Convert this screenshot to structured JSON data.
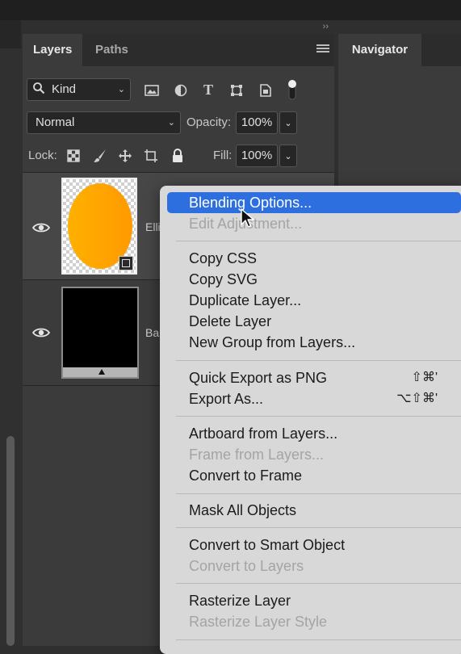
{
  "header": {
    "collapse_glyph": "››"
  },
  "panel": {
    "tabs": [
      {
        "label": "Layers"
      },
      {
        "label": "Paths"
      }
    ],
    "navigator_tab": "Navigator"
  },
  "filter": {
    "kind_label": "Kind"
  },
  "blend": {
    "mode": "Normal",
    "opacity_label": "Opacity:",
    "opacity_value": "100%"
  },
  "lock": {
    "label": "Lock:",
    "fill_label": "Fill:",
    "fill_value": "100%"
  },
  "layers": [
    {
      "name": "Elli",
      "thumb": "orange-ellipse"
    },
    {
      "name": "Ba",
      "thumb": "black-artboard"
    }
  ],
  "context_menu": {
    "groups": [
      [
        {
          "label": "Blending Options...",
          "highlighted": true
        },
        {
          "label": "Edit Adjustment...",
          "disabled": true
        }
      ],
      [
        {
          "label": "Copy CSS"
        },
        {
          "label": "Copy SVG"
        },
        {
          "label": "Duplicate Layer..."
        },
        {
          "label": "Delete Layer"
        },
        {
          "label": "New Group from Layers..."
        }
      ],
      [
        {
          "label": "Quick Export as PNG",
          "shortcut": "⇧⌘'"
        },
        {
          "label": "Export As...",
          "shortcut": "⌥⇧⌘'"
        }
      ],
      [
        {
          "label": "Artboard from Layers..."
        },
        {
          "label": "Frame from Layers...",
          "disabled": true
        },
        {
          "label": "Convert to Frame"
        }
      ],
      [
        {
          "label": "Mask All Objects"
        }
      ],
      [
        {
          "label": "Convert to Smart Object"
        },
        {
          "label": "Convert to Layers",
          "disabled": true
        }
      ],
      [
        {
          "label": "Rasterize Layer"
        },
        {
          "label": "Rasterize Layer Style",
          "disabled": true
        }
      ]
    ]
  },
  "colors": {
    "highlight": "#2e6fe0",
    "ellipse_fill": "#ffa800",
    "menu_bg": "#d8d8d8"
  }
}
